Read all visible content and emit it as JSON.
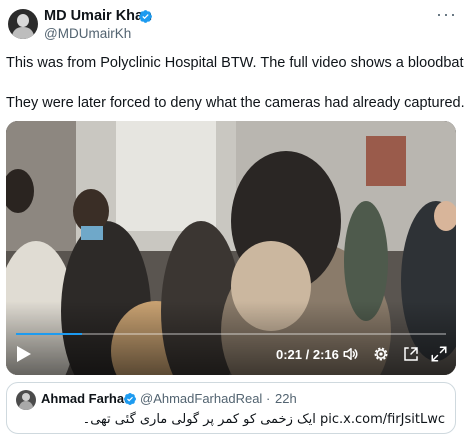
{
  "author": {
    "display_name": "MD Umair Khan",
    "handle": "@MDUmairKh",
    "verified": true,
    "avatar_icon": "profile-avatar"
  },
  "menu": {
    "more_icon": "more-horizontal-icon",
    "label": "···"
  },
  "tweet": {
    "line1": "This was from Polyclinic Hospital BTW. The full video shows a bloodbath.",
    "line2": "They were later forced to deny what the cameras had already captured."
  },
  "video": {
    "time_display": "0:21 / 2:16",
    "progress_fraction": 0.154,
    "accent_color": "#1d9bf0",
    "controls": [
      "play-icon",
      "volume-icon",
      "settings-icon",
      "picture-in-picture-icon",
      "fullscreen-icon"
    ]
  },
  "quote": {
    "display_name": "Ahmad Farhad",
    "verified": true,
    "handle": "@AhmadFarhadReal",
    "separator": "·",
    "time": "22h",
    "text": "pic.x.com/firJsitLwc ایک زخمی کو کمر پر گولی ماری گئی تھی۔"
  },
  "colors": {
    "text": "#0f1419",
    "secondary": "#536471",
    "verified": "#1d9bf0",
    "border": "#cfd9de"
  }
}
